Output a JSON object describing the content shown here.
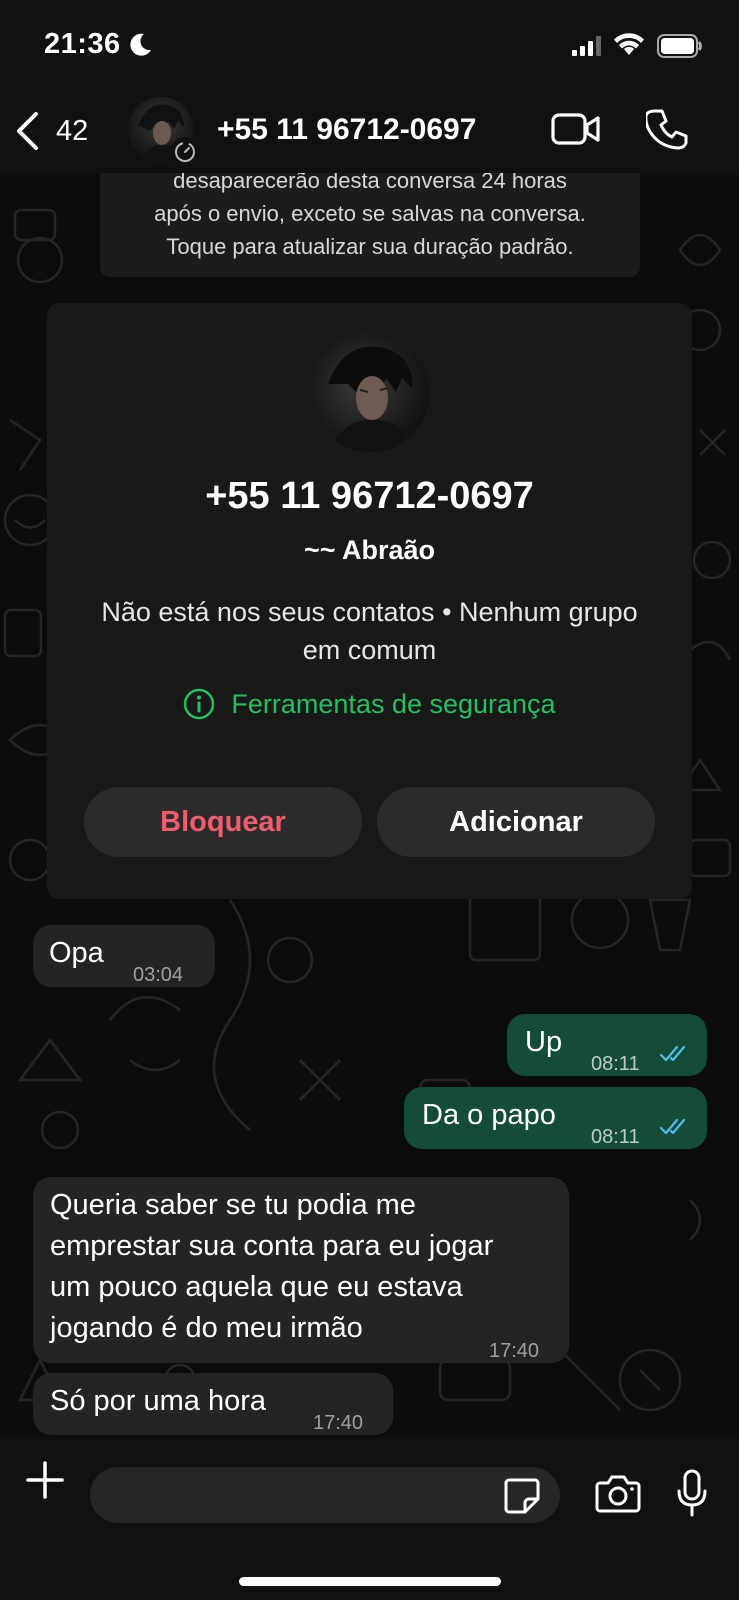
{
  "status_bar": {
    "time": "21:36"
  },
  "header": {
    "back_count": "42",
    "title": "+55 11 96712-0697"
  },
  "notice": {
    "lines": [
      "desaparecerão desta conversa 24 horas",
      "após o envio, exceto se salvas na conversa.",
      "Toque para atualizar sua duração padrão."
    ]
  },
  "contact_card": {
    "phone": "+55 11 96712-0697",
    "name": "~~ Abraão",
    "info_line1": "Não está nos seus contatos • Nenhum grupo",
    "info_line2": "em comum",
    "safety_tools": "Ferramentas de segurança",
    "block_label": "Bloquear",
    "add_label": "Adicionar"
  },
  "messages": [
    {
      "direction": "in",
      "text": "Opa",
      "time": "03:04"
    },
    {
      "direction": "out",
      "text": "Up",
      "time": "08:11",
      "status": "read"
    },
    {
      "direction": "out",
      "text": "Da o papo",
      "time": "08:11",
      "status": "read"
    },
    {
      "direction": "in",
      "lines": [
        "Queria saber se tu podia me",
        "emprestar sua conta para eu jogar",
        "um pouco aquela que eu estava",
        "jogando é do meu irmão"
      ],
      "time": "17:40"
    },
    {
      "direction": "in",
      "text": "Só por uma hora",
      "time": "17:40"
    }
  ],
  "composer": {
    "placeholder": ""
  },
  "colors": {
    "accent_green": "#21c063",
    "block_red": "#f15c6d",
    "outgoing_bubble": "#144d37",
    "incoming_bubble": "#242426",
    "read_ticks": "#53bdeb"
  },
  "icons": [
    "moon-icon",
    "signal-icon",
    "wifi-icon",
    "battery-icon",
    "back-chevron-icon",
    "disappearing-timer-icon",
    "video-call-icon",
    "phone-icon",
    "info-icon",
    "double-check-icon",
    "plus-icon",
    "sticker-icon",
    "camera-icon",
    "mic-icon"
  ]
}
